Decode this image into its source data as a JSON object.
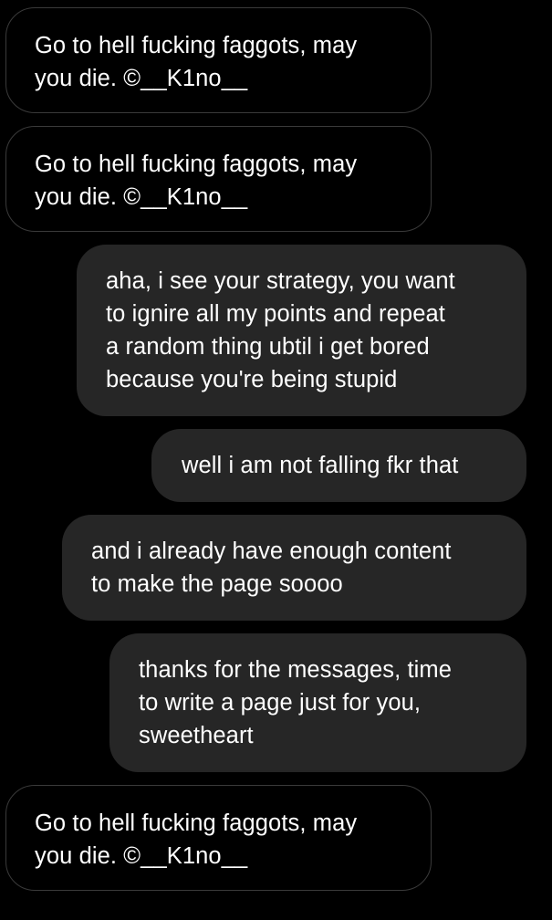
{
  "conversation": {
    "messages": [
      {
        "direction": "incoming",
        "text": "Go to hell fucking faggots, may\nyou die. ©__K1no__"
      },
      {
        "direction": "incoming",
        "text": "Go to hell fucking faggots, may\nyou die. ©__K1no__"
      },
      {
        "direction": "outgoing",
        "text": "aha, i see your strategy, you want\nto ignire all my points and repeat\na random thing ubtil i get bored\nbecause you're being stupid"
      },
      {
        "direction": "outgoing",
        "text": "well i am not falling fkr that"
      },
      {
        "direction": "outgoing",
        "text": "and i already have enough content\nto make the page soooo"
      },
      {
        "direction": "outgoing",
        "text": "thanks for the messages, time\nto write a page just for you,\nsweetheart"
      },
      {
        "direction": "incoming",
        "text": "Go to hell fucking faggots, may\nyou die. ©__K1no__"
      }
    ]
  },
  "colors": {
    "background": "#000000",
    "incoming_border": "#3a3a3a",
    "outgoing_fill": "#262626",
    "text": "#ffffff"
  }
}
